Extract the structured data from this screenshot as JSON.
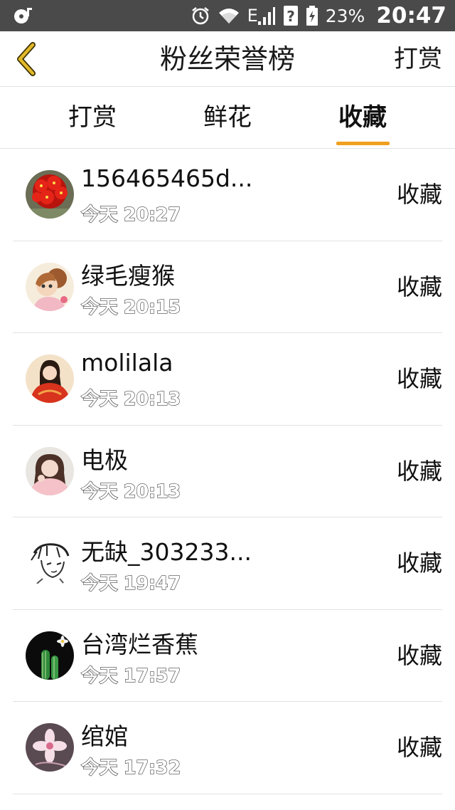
{
  "status_bar": {
    "network": "E",
    "battery": "23%",
    "time": "20:47"
  },
  "header": {
    "title": "粉丝荣誉榜",
    "right_action": "打赏",
    "back_icon": "chevron-left-icon"
  },
  "tabs": [
    {
      "label": "打赏",
      "active": false
    },
    {
      "label": "鲜花",
      "active": false
    },
    {
      "label": "收藏",
      "active": true
    }
  ],
  "colors": {
    "accent": "#f0a020",
    "status_bar_bg": "#4a4a4a",
    "back_icon": "#d4a017"
  },
  "list": [
    {
      "name": "156465465d...",
      "time": "今天 20:27",
      "action": "收藏",
      "avatar": "red-flower"
    },
    {
      "name": "绿毛瘦猴",
      "time": "今天 20:15",
      "action": "收藏",
      "avatar": "cartoon-girl"
    },
    {
      "name": "molilala",
      "time": "今天 20:13",
      "action": "收藏",
      "avatar": "doll-red-dress"
    },
    {
      "name": "电极",
      "time": "今天 20:13",
      "action": "收藏",
      "avatar": "girl-photo"
    },
    {
      "name": "无缺_303233...",
      "time": "今天 19:47",
      "action": "收藏",
      "avatar": "sketch-face"
    },
    {
      "name": "台湾烂香蕉",
      "time": "今天 17:57",
      "action": "收藏",
      "avatar": "cactus-flower"
    },
    {
      "name": "绾婠",
      "time": "今天 17:32",
      "action": "收藏",
      "avatar": "pink-blossom"
    }
  ]
}
